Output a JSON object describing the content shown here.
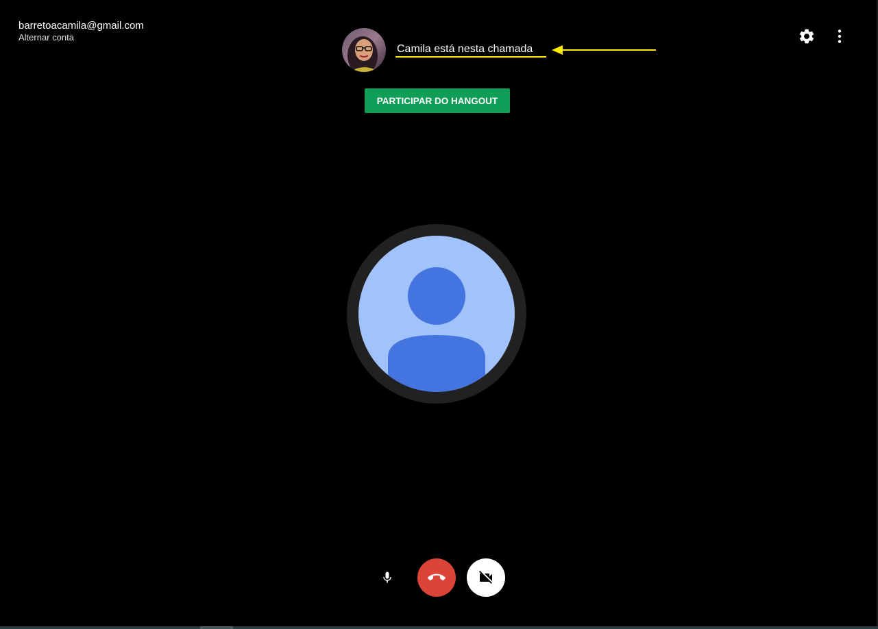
{
  "account": {
    "email": "barretoacamila@gmail.com",
    "switch_label": "Alternar conta"
  },
  "participant": {
    "status_text": "Camila está nesta chamada",
    "avatar_icon": "user-photo"
  },
  "actions": {
    "join_label": "PARTICIPAR DO HANGOUT"
  },
  "toolbar": {
    "settings_icon": "gear-icon",
    "more_icon": "more-vert-icon"
  },
  "controls": {
    "mic_icon": "microphone-icon",
    "hangup_icon": "hangup-icon",
    "camera_icon": "camera-off-icon"
  },
  "colors": {
    "background": "#000000",
    "join_button": "#0f9d58",
    "hangup": "#db4437",
    "annotation": "#ffeb00",
    "avatar_light": "#a1c2fa",
    "avatar_dark": "#4374e0"
  }
}
